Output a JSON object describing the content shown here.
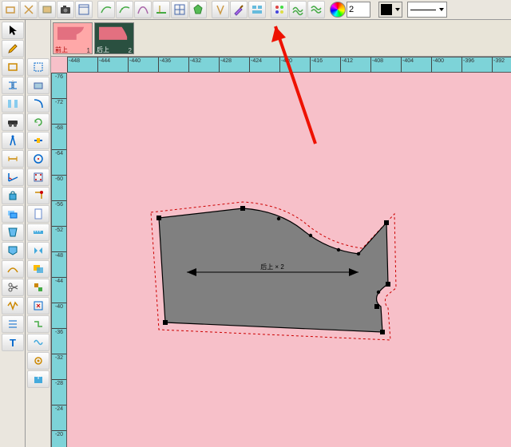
{
  "toolbar": {
    "number_value": "2"
  },
  "patterns": {
    "p1": {
      "label": "前上",
      "num": "1"
    },
    "p2": {
      "label": "后上",
      "num": "2"
    }
  },
  "ruler_h": [
    "-448",
    "-444",
    "-440",
    "-436",
    "-432",
    "-428",
    "-424",
    "-420",
    "-416",
    "-412",
    "-408",
    "-404",
    "-400",
    "-396",
    "-392"
  ],
  "ruler_v": [
    "-76",
    "-72",
    "-68",
    "-64",
    "-60",
    "-56",
    "-52",
    "-48",
    "-44",
    "-40",
    "-36",
    "-32",
    "-28",
    "-24",
    "-20"
  ],
  "piece": {
    "label": "后上 × 2"
  }
}
